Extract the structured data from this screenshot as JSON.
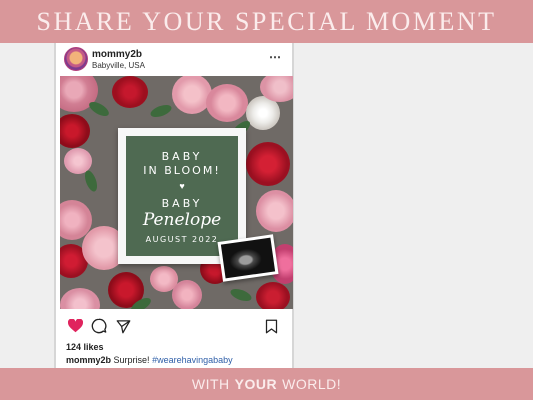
{
  "banner_top": {
    "text": "SHARE YOUR SPECIAL MOMENT"
  },
  "banner_bottom": {
    "prefix": "WITH",
    "highlight": "YOUR",
    "suffix": "WORLD!"
  },
  "post": {
    "username": "mommy2b",
    "location": "Babyville, USA",
    "more_icon": "⋯",
    "letterboard": {
      "line1": "BABY",
      "line2": "IN BLOOM!",
      "heart": "♥",
      "line3": "BABY",
      "name": "Penelope",
      "date": "AUGUST 2022"
    },
    "icons": {
      "like": "heart-icon",
      "comment": "comment-icon",
      "share": "send-icon",
      "save": "bookmark-icon"
    },
    "likes": "124 likes",
    "caption_user": "mommy2b",
    "caption_text": "Surprise!",
    "caption_tag": "#wearehavingababy"
  },
  "colors": {
    "banner": "#d9979a",
    "banner_text": "#fbecec",
    "like": "#e0245e",
    "felt": "#4f6a52"
  }
}
